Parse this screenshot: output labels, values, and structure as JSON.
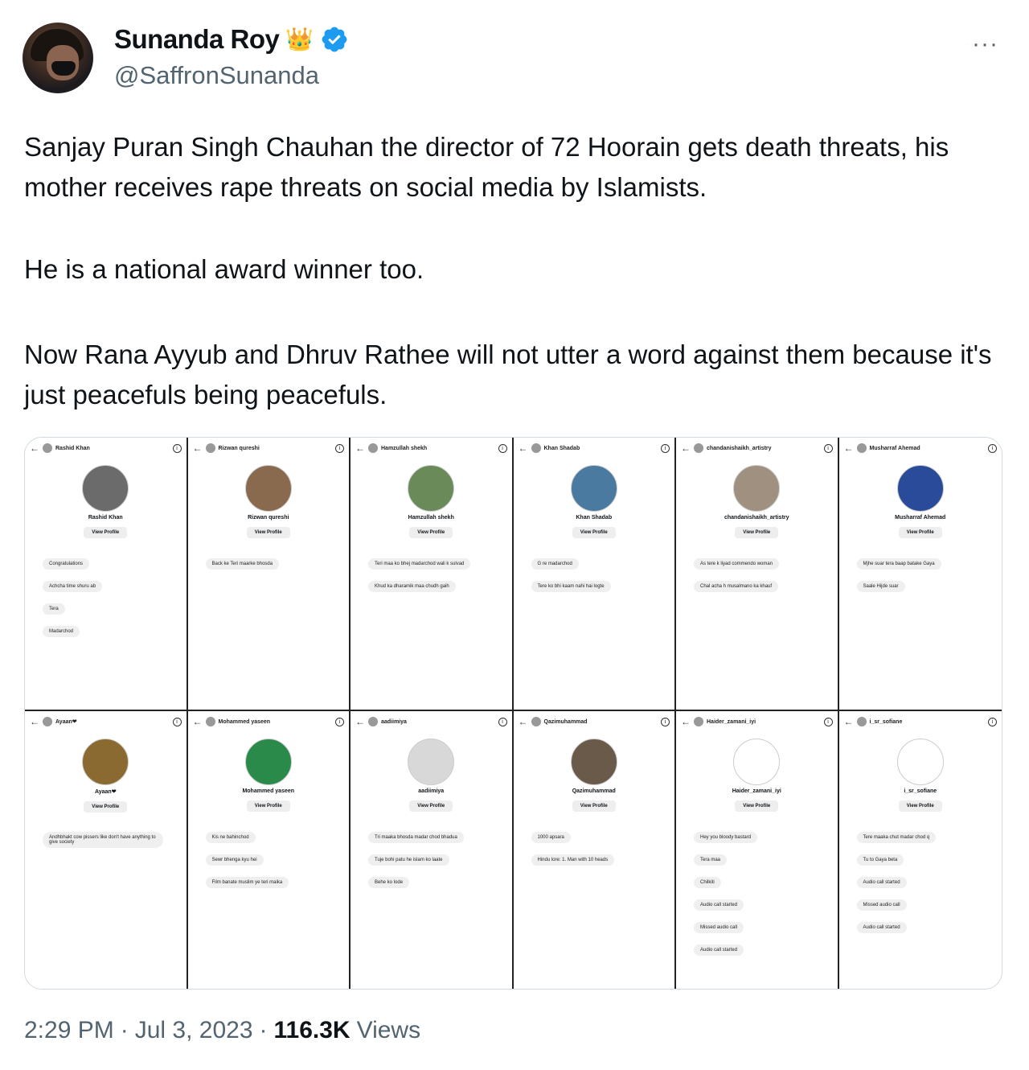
{
  "author": {
    "name": "Sunanda Roy",
    "badge_emoji": "👑",
    "handle": "@SaffronSunanda",
    "verified": true,
    "verified_color": "#1d9bf0"
  },
  "more_icon": "···",
  "tweet": {
    "paragraph_1": "Sanjay Puran Singh Chauhan the director of 72 Hoorain gets death threats, his mother receives rape threats on social media by Islamists.",
    "paragraph_2": "He is a national award winner too.",
    "paragraph_3": "Now Rana Ayyub and Dhruv Rathee will not utter a word against them because it's just peacefuls being peacefuls."
  },
  "screenshots": [
    {
      "user": "Rashid Khan",
      "pic_color": "#6b6b6b",
      "btn": "View Profile",
      "bubbles": [
        "Congratulations",
        "Achcha time shuru ab",
        "Tera",
        "Madarchod"
      ]
    },
    {
      "user": "Rizwan qureshi",
      "pic_color": "#8a6a4e",
      "btn": "View Profile",
      "bubbles": [
        "Back ke Teri maarke bhosda"
      ]
    },
    {
      "user": "Hamzullah shekh",
      "pic_color": "#6a8a5a",
      "btn": "View Profile",
      "bubbles": [
        "Teri maa ko bhej madarchod wali k sulvad",
        "Khud ka dharamik maa chudh gaih"
      ]
    },
    {
      "user": "Khan Shadab",
      "pic_color": "#4a7aa0",
      "btn": "View Profile",
      "bubbles": [
        "G re madarchod",
        "Tere ko bhi kaam nahi hai logte"
      ]
    },
    {
      "user": "chandanishaikh_artistry",
      "pic_color": "#a09080",
      "btn": "View Profile",
      "bubbles": [
        "As tere k liyad commendo woman",
        "Chal acha h musalmano ka khauf"
      ]
    },
    {
      "user": "Musharraf Ahemad",
      "pic_color": "#2a4a9a",
      "btn": "View Profile",
      "bubbles": [
        "Mjhe suar tera baap batake Gaya",
        "Saale Hijde suar"
      ]
    },
    {
      "user": "Ayaan❤",
      "pic_color": "#8a6a30",
      "btn": "View Profile",
      "bubbles": [
        "Andhbhakt cow pissers like don't have anything to give society"
      ]
    },
    {
      "user": "Mohammed yaseen",
      "pic_color": "#2a8a4a",
      "btn": "View Profile",
      "bubbles": [
        "Kis ne bahinchod",
        "Sewr bhenga kyu hei",
        "Film banate muslim ye teri maika"
      ]
    },
    {
      "user": "aadiimiya",
      "pic_color": "#d8d8d8",
      "btn": "View Profile",
      "bubbles": [
        "Tri maaka bhosda madar chod bhadua",
        "Tuje bohi patu he islam ko laate",
        "Behe ko lode"
      ]
    },
    {
      "user": "Qazimuhammad",
      "pic_color": "#6a5a4a",
      "btn": "View Profile",
      "bubbles": [
        "1000 apsara",
        "Hindu lore: 1. Man with 10 heads"
      ]
    },
    {
      "user": "Haider_zamani_iyi",
      "pic_color": "#ffffff",
      "btn": "View Profile",
      "bubbles": [
        "Hey you bloody bastard",
        "Tera maa",
        "Chilkiti",
        "Audio call started",
        "Missed audio call",
        "Audio call started"
      ]
    },
    {
      "user": "i_sr_sofiane",
      "pic_color": "#ffffff",
      "btn": "View Profile",
      "bubbles": [
        "Tere maaka chut madar chod q",
        "Tu to Gaya beta",
        "Audio call started",
        "Missed audio call",
        "Audio call started"
      ]
    }
  ],
  "footer": {
    "time": "2:29 PM",
    "date": "Jul 3, 2023",
    "views_count": "116.3K",
    "views_label": "Views",
    "sep": "·"
  }
}
